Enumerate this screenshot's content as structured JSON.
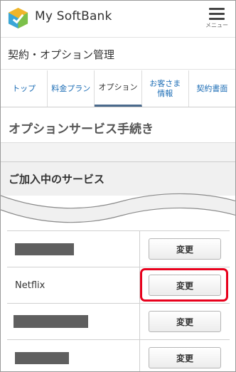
{
  "header": {
    "app_title": "My SoftBank",
    "menu_label": "メニュー"
  },
  "section_title": "契約・オプション管理",
  "tabs": [
    {
      "label": "トップ",
      "active": false
    },
    {
      "label": "料金プラン",
      "active": false
    },
    {
      "label": "オプション",
      "active": true
    },
    {
      "label": "お客さま 情報",
      "active": false
    },
    {
      "label": "契約書面",
      "active": false
    }
  ],
  "page_heading": "オプションサービス手続き",
  "card_heading": "ご加入中のサービス",
  "services": [
    {
      "name": "",
      "redacted": true,
      "button_label": "変更"
    },
    {
      "name": "Netflix",
      "redacted": false,
      "button_label": "変更",
      "highlighted": true
    },
    {
      "name": "",
      "redacted": true,
      "button_label": "変更"
    },
    {
      "name": "",
      "redacted": true,
      "button_label": "変更"
    }
  ],
  "colors": {
    "highlight": "#e8001c",
    "tab_link": "#1b6cb5",
    "active_tab_underline": "#4a6a8c"
  }
}
